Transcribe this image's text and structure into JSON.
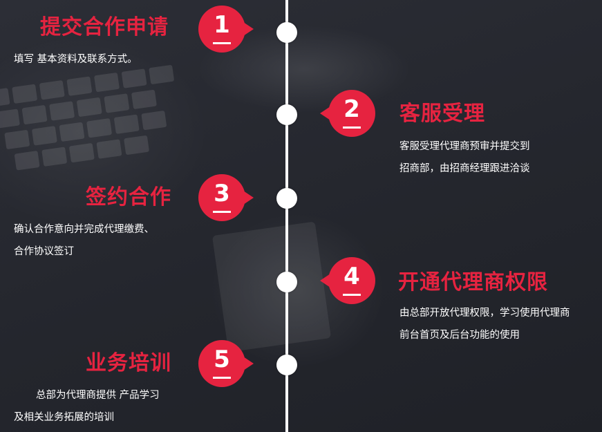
{
  "steps": [
    {
      "num": "1",
      "title": "提交合作申请",
      "lines": [
        "填写 基本资料及联系方式。"
      ]
    },
    {
      "num": "2",
      "title": "客服受理",
      "lines": [
        "客服受理代理商预审并提交到",
        "招商部，由招商经理跟进洽谈"
      ]
    },
    {
      "num": "3",
      "title": "签约合作",
      "lines": [
        "确认合作意向并完成代理缴费、",
        "合作协议签订"
      ]
    },
    {
      "num": "4",
      "title": "开通代理商权限",
      "lines": [
        "由总部开放代理权限，学习使用代理商",
        "前台首页及后台功能的使用"
      ]
    },
    {
      "num": "5",
      "title": "业务培训",
      "lines": [
        "总部为代理商提供 产品学习",
        "及相关业务拓展的培训"
      ]
    }
  ],
  "colors": {
    "accent": "#e62340",
    "line": "#ffffff"
  }
}
